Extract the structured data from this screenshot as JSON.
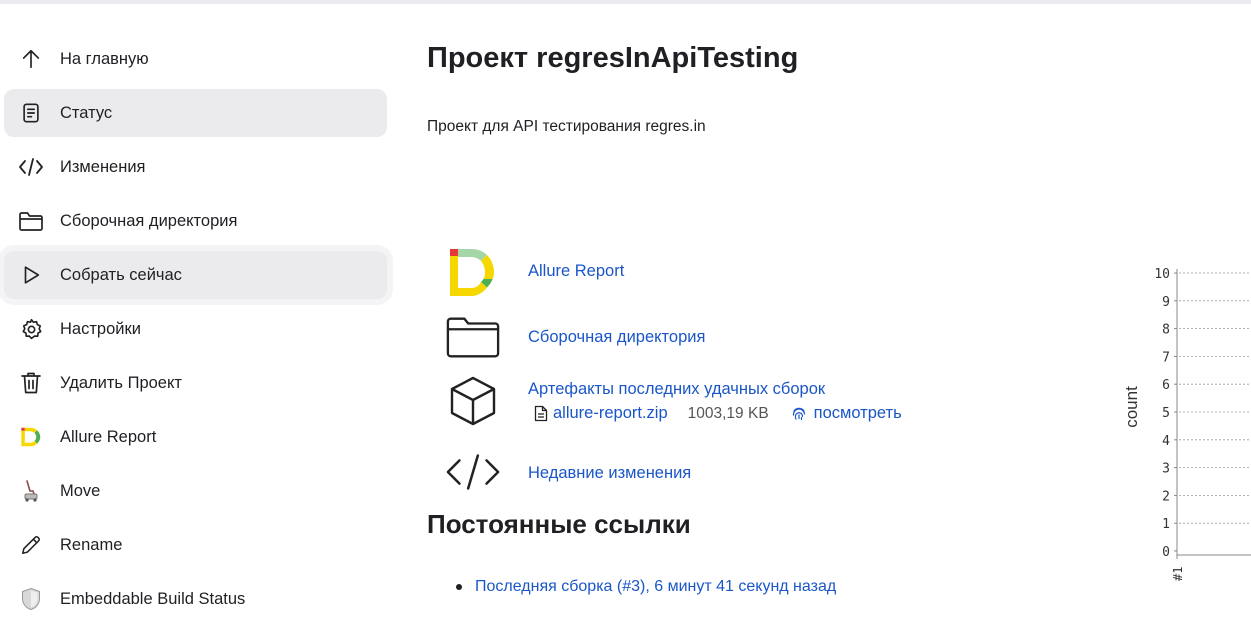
{
  "sidebar": {
    "items": [
      {
        "label": "На главную",
        "icon": "arrow-up-icon"
      },
      {
        "label": "Статус",
        "icon": "document-icon"
      },
      {
        "label": "Изменения",
        "icon": "code-icon"
      },
      {
        "label": "Сборочная директория",
        "icon": "folder-icon"
      },
      {
        "label": "Собрать сейчас",
        "icon": "play-icon"
      },
      {
        "label": "Настройки",
        "icon": "gear-icon"
      },
      {
        "label": "Удалить Проект",
        "icon": "trash-icon"
      },
      {
        "label": "Allure Report",
        "icon": "allure-logo-icon"
      },
      {
        "label": "Move",
        "icon": "move-icon"
      },
      {
        "label": "Rename",
        "icon": "pencil-icon"
      },
      {
        "label": "Embeddable Build Status",
        "icon": "shield-icon"
      }
    ]
  },
  "main": {
    "title": "Проект regresInApiTesting",
    "description": "Проект для API тестирования regres.in",
    "links": {
      "allure": "Allure Report",
      "workspace": "Сборочная директория",
      "artifacts": "Артефакты последних удачных сборок",
      "changes": "Недавние изменения"
    },
    "artifact": {
      "file": "allure-report.zip",
      "size": "1003,19 KB",
      "view": "посмотреть"
    },
    "permalinks_heading": "Постоянные ссылки",
    "permalinks": [
      "Последняя сборка (#3), 6 минут 41 секунд назад"
    ]
  },
  "chart_data": {
    "type": "line",
    "ylabel": "count",
    "ylim": [
      0,
      10
    ],
    "y_ticks": [
      "0",
      "1",
      "2",
      "3",
      "4",
      "5",
      "6",
      "7",
      "8",
      "9",
      "10"
    ],
    "x_ticks": [
      "#1"
    ],
    "grid": true
  },
  "colors": {
    "link": "#1a56c8",
    "active_bg": "#ebebee"
  }
}
